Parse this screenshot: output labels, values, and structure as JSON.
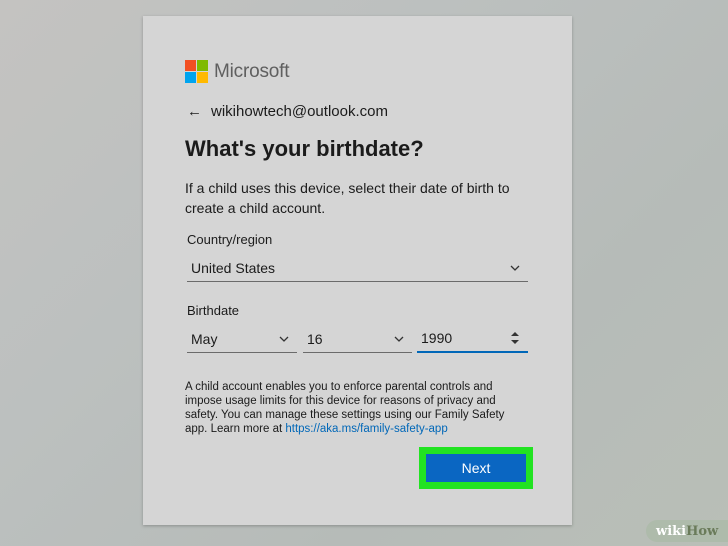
{
  "brand": {
    "name": "Microsoft",
    "colors": [
      "#f25022",
      "#7fba00",
      "#00a4ef",
      "#ffb900"
    ]
  },
  "account": {
    "email": "wikihowtech@outlook.com",
    "back_icon": "left-arrow-icon"
  },
  "heading": "What's your birthdate?",
  "description": "If a child uses this device, select their date of birth to create a child account.",
  "country": {
    "label": "Country/region",
    "value": "United States"
  },
  "birthdate": {
    "label": "Birthdate",
    "month": "May",
    "day": "16",
    "year": "1990"
  },
  "notice": {
    "text": "A child account enables you to enforce parental controls and impose usage limits for this device for reasons of privacy and safety. You can manage these settings using our Family Safety app. Learn more at ",
    "link": "https://aka.ms/family-safety-app"
  },
  "next_label": "Next",
  "accent_color": "#0a66c2",
  "highlight_color": "#22e322",
  "watermark": {
    "part1": "wiki",
    "part2": "How"
  }
}
